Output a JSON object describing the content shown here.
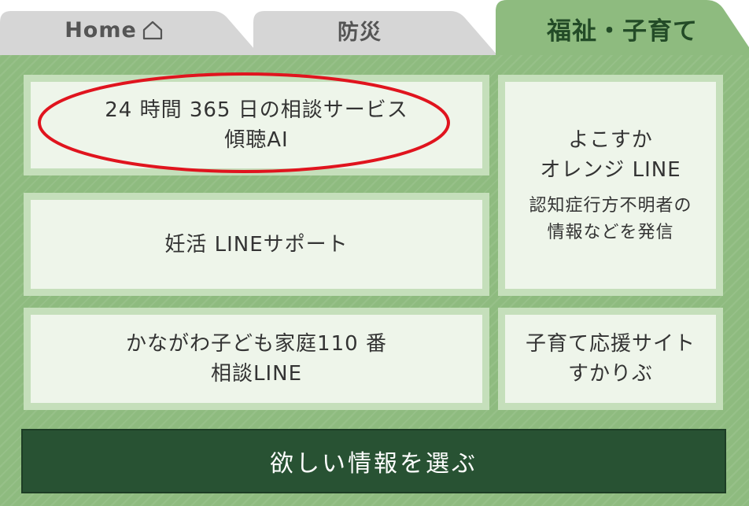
{
  "tabs": {
    "home": {
      "label": "Home",
      "icon": "home-icon"
    },
    "bousai": {
      "label": "防災"
    },
    "fukushi": {
      "label": "福祉・子育て"
    }
  },
  "cards": {
    "soudan": {
      "line1": "24 時間 365 日の相談サービス",
      "line2": "傾聴AI"
    },
    "ninkatsu": {
      "line1": "妊活 LINEサポート"
    },
    "kanagawa": {
      "line1": "かながわ子ども家庭110 番",
      "line2": "相談LINE"
    },
    "orange": {
      "line1": "よこすか",
      "line2": "オレンジ LINE",
      "sub1": "認知症行方不明者の",
      "sub2": "情報などを発信"
    },
    "kosodate": {
      "line1": "子育て応援サイト",
      "line2": "すかりぶ"
    }
  },
  "select": {
    "label": "欲しい情報を選ぶ"
  },
  "colors": {
    "panel": "#8ebb7f",
    "card_border": "#c5dfbb",
    "card_fill": "#eef5ea",
    "active_tab": "#8ebb7f",
    "inactive_tab": "#d6d6d6",
    "select_bar": "#285233",
    "highlight_ellipse": "#e0141e"
  }
}
